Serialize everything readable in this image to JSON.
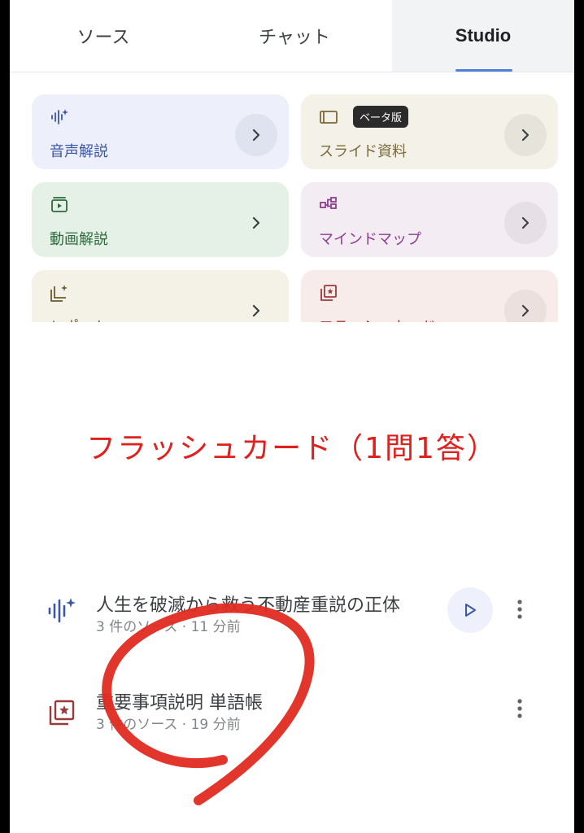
{
  "tabs": [
    "ソース",
    "チャット",
    "Studio"
  ],
  "active_tab": "Studio",
  "studio_tools": [
    {
      "label": "音声解説",
      "icon": "audio-waveform-icon"
    },
    {
      "label": "スライド資料",
      "icon": "slides-icon",
      "badge": "ベータ版"
    },
    {
      "label": "動画解説",
      "icon": "video-icon"
    },
    {
      "label": "マインドマップ",
      "icon": "mind-map-icon"
    },
    {
      "label": "レポート",
      "icon": "report-icon"
    },
    {
      "label": "フラッシュカード",
      "icon": "flashcard-icon"
    }
  ],
  "annotation": "フラッシュカード（1問1答）",
  "outputs": [
    {
      "title": "人生を破滅から救う不動産重説の正体",
      "meta": "3 件のソース · 11 分前",
      "icon": "audio-waveform-icon"
    },
    {
      "title": "重要事項説明 単語帳",
      "meta": "3 件のソース · 19 分前",
      "icon": "flashcard-icon"
    }
  ],
  "colors": {
    "annotation": "#e0201c",
    "active_tab_underline": "#4f7fd9",
    "audio": "#3d57a8",
    "video": "#2e6a3d",
    "mind_map": "#8e3f8f",
    "flashcard": "#9a3a3a"
  }
}
